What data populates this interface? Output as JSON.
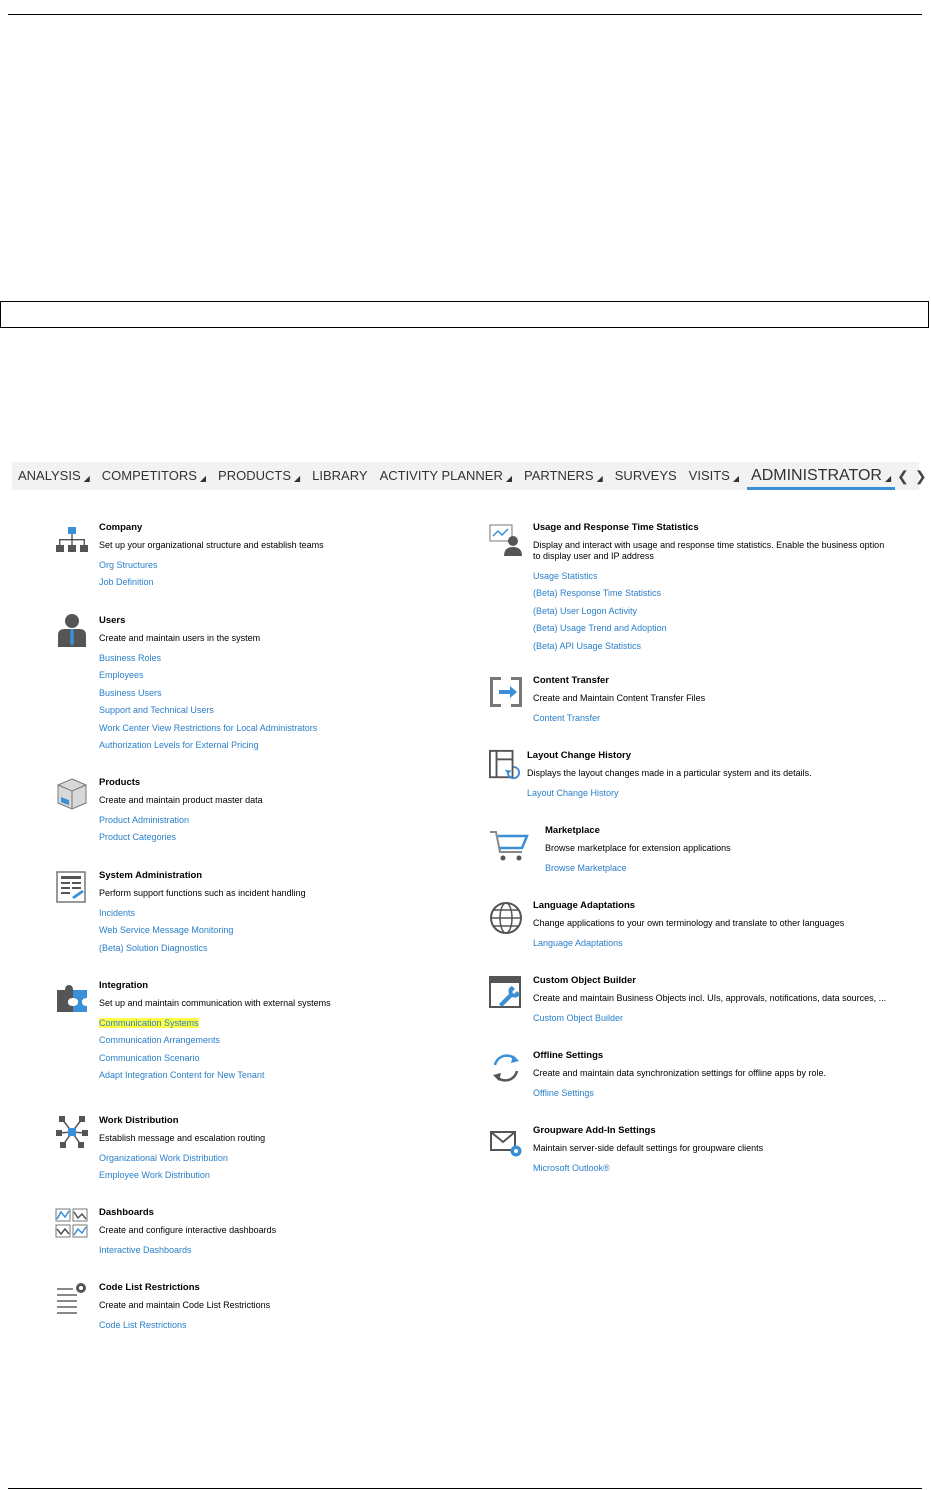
{
  "nav": {
    "tabs": [
      {
        "label": "ANALYSIS",
        "dropdown": true
      },
      {
        "label": "COMPETITORS",
        "dropdown": true
      },
      {
        "label": "PRODUCTS",
        "dropdown": true
      },
      {
        "label": "LIBRARY",
        "dropdown": false
      },
      {
        "label": "ACTIVITY PLANNER",
        "dropdown": true
      },
      {
        "label": "PARTNERS",
        "dropdown": true
      },
      {
        "label": "SURVEYS",
        "dropdown": false
      },
      {
        "label": "VISITS",
        "dropdown": true
      },
      {
        "label": "ADMINISTRATOR",
        "dropdown": true,
        "active": true
      }
    ]
  },
  "left": [
    {
      "title": "Company",
      "desc": "Set up your organizational structure and establish teams",
      "icon": "org-chart-icon",
      "links": [
        "Org Structures",
        "Job Definition"
      ]
    },
    {
      "title": "Users",
      "desc": "Create and maintain users in the system",
      "icon": "user-icon",
      "links": [
        "Business Roles",
        "Employees",
        "Business Users",
        "Support and Technical Users",
        "Work Center View Restrictions for Local Administrators",
        "Authorization Levels for External Pricing"
      ]
    },
    {
      "title": "Products",
      "desc": "Create and maintain product master data",
      "icon": "product-box-icon",
      "links": [
        "Product Administration",
        "Product Categories"
      ]
    },
    {
      "title": "System Administration",
      "desc": "Perform support functions such as incident handling",
      "icon": "system-admin-icon",
      "links": [
        "Incidents",
        "Web Service Message Monitoring",
        "(Beta) Solution Diagnostics"
      ]
    },
    {
      "title": "Integration",
      "desc": "Set up and maintain communication with external systems",
      "icon": "puzzle-icon",
      "links": [
        "Communication Systems",
        "Communication Arrangements",
        "Communication Scenario",
        "Adapt Integration Content for New Tenant"
      ],
      "highlight": 0
    },
    {
      "title": "Work Distribution",
      "desc": "Establish message and escalation routing",
      "icon": "network-icon",
      "links": [
        "Organizational Work Distribution",
        "Employee Work Distribution"
      ]
    },
    {
      "title": "Dashboards",
      "desc": "Create and configure interactive dashboards",
      "icon": "dashboard-icon",
      "links": [
        "Interactive Dashboards"
      ]
    },
    {
      "title": "Code List Restrictions",
      "desc": "Create and maintain Code List Restrictions",
      "icon": "list-gear-icon",
      "links": [
        "Code List Restrictions"
      ]
    }
  ],
  "right": [
    {
      "title": "Usage and Response Time Statistics",
      "desc": "Display and interact with usage and response time statistics. Enable the business option",
      "desc2": "to display user and IP address",
      "icon": "usage-stats-icon",
      "links": [
        "Usage Statistics",
        "(Beta) Response Time Statistics",
        "(Beta) User Logon Activity",
        "(Beta) Usage Trend and Adoption",
        "(Beta) API Usage Statistics"
      ]
    },
    {
      "title": "Content Transfer",
      "desc": "Create and Maintain Content Transfer Files",
      "icon": "content-transfer-icon",
      "links": [
        "Content Transfer"
      ]
    },
    {
      "title": "Layout Change History",
      "desc": "Displays the layout changes made in a particular system and its details.",
      "icon": "layout-history-icon",
      "links": [
        "Layout Change History"
      ]
    },
    {
      "title": "Marketplace",
      "desc": "Browse marketplace for extension applications",
      "icon": "cart-icon",
      "links": [
        "Browse Marketplace"
      ]
    },
    {
      "title": "Language Adaptations",
      "desc": "Change applications to your own terminology and translate to other languages",
      "icon": "globe-icon",
      "links": [
        "Language Adaptations"
      ]
    },
    {
      "title": "Custom Object Builder",
      "desc": "Create and maintain Business Objects incl. UIs, approvals, notifications, data sources, ...",
      "icon": "object-builder-icon",
      "links": [
        "Custom Object Builder"
      ]
    },
    {
      "title": "Offline Settings",
      "desc": "Create and maintain data synchronization settings for offline apps by role.",
      "icon": "sync-icon",
      "links": [
        "Offline Settings"
      ]
    },
    {
      "title": "Groupware Add-In Settings",
      "desc": "Maintain server-side default settings for groupware clients",
      "icon": "mail-gear-icon",
      "links": [
        "Microsoft Outlook®"
      ]
    }
  ]
}
